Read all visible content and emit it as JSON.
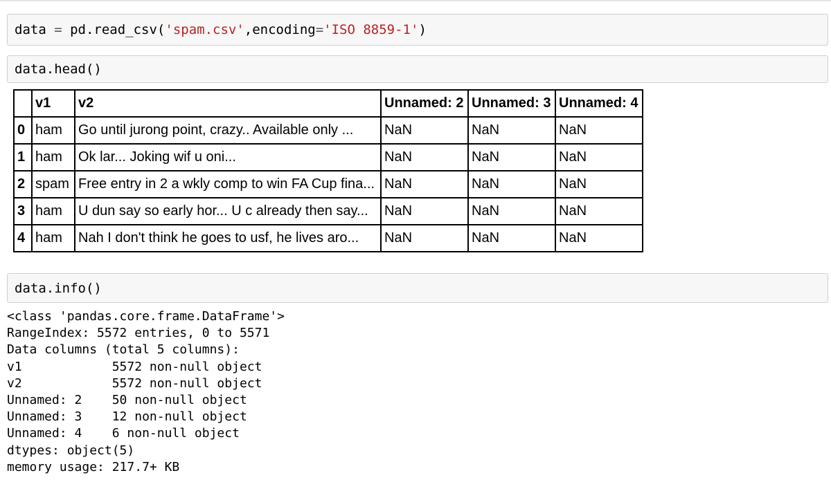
{
  "cells": [
    {
      "tokens": [
        {
          "text": "data ",
          "kind": "plain"
        },
        {
          "text": "=",
          "kind": "op"
        },
        {
          "text": " pd.read_csv(",
          "kind": "plain"
        },
        {
          "text": "'spam.csv'",
          "kind": "string"
        },
        {
          "text": ",encoding",
          "kind": "plain"
        },
        {
          "text": "=",
          "kind": "op"
        },
        {
          "text": "'ISO 8859-1'",
          "kind": "string"
        },
        {
          "text": ")",
          "kind": "plain"
        }
      ]
    },
    {
      "tokens": [
        {
          "text": "data.head()",
          "kind": "plain"
        }
      ]
    },
    {
      "tokens": [
        {
          "text": "data.info()",
          "kind": "plain"
        }
      ]
    }
  ],
  "dataframe": {
    "columns": [
      "",
      "v1",
      "v2",
      "Unnamed: 2",
      "Unnamed: 3",
      "Unnamed: 4"
    ],
    "rows": [
      [
        "0",
        "ham",
        "Go until jurong point, crazy.. Available only ...",
        "NaN",
        "NaN",
        "NaN"
      ],
      [
        "1",
        "ham",
        "Ok lar... Joking wif u oni...",
        "NaN",
        "NaN",
        "NaN"
      ],
      [
        "2",
        "spam",
        "Free entry in 2 a wkly comp to win FA Cup fina...",
        "NaN",
        "NaN",
        "NaN"
      ],
      [
        "3",
        "ham",
        "U dun say so early hor... U c already then say...",
        "NaN",
        "NaN",
        "NaN"
      ],
      [
        "4",
        "ham",
        "Nah I don't think he goes to usf, he lives aro...",
        "NaN",
        "NaN",
        "NaN"
      ]
    ]
  },
  "info_output": [
    "<class 'pandas.core.frame.DataFrame'>",
    "RangeIndex: 5572 entries, 0 to 5571",
    "Data columns (total 5 columns):",
    "v1            5572 non-null object",
    "v2            5572 non-null object",
    "Unnamed: 2    50 non-null object",
    "Unnamed: 3    12 non-null object",
    "Unnamed: 4    6 non-null object",
    "dtypes: object(5)",
    "memory usage: 217.7+ KB"
  ]
}
